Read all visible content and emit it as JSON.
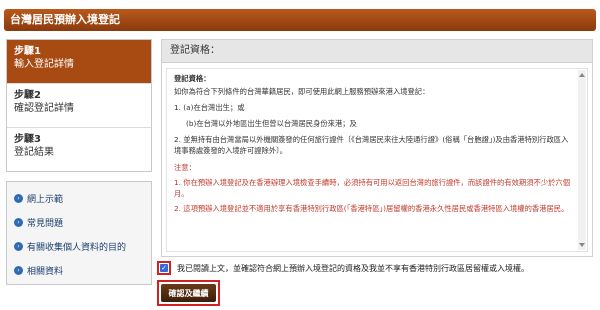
{
  "header": {
    "title": "台灣居民預辦入境登記"
  },
  "steps": [
    {
      "num": "步驟1",
      "label": "輸入登記詳情"
    },
    {
      "num": "步驟2",
      "label": "確認登記詳情"
    },
    {
      "num": "步驟3",
      "label": "登記結果"
    }
  ],
  "links": [
    {
      "icon": "arrow-circle-icon",
      "label": "網上示範"
    },
    {
      "icon": "arrow-circle-icon",
      "label": "常見問題"
    },
    {
      "icon": "arrow-circle-icon",
      "label": "有關收集個人資料的目的"
    },
    {
      "icon": "arrow-circle-icon",
      "label": "相關資料"
    }
  ],
  "panel": {
    "header": "登記資格：",
    "title": "登記資格：",
    "intro": "如你為符合下列條件的台灣華籍居民，即可使用此網上服務預辦來港入境登記：",
    "item1": "1. (a)在台灣出生；或",
    "item1b": "(b)在台灣以外地區出生但曾以台灣居民身份來港；及",
    "item2": "2. 並無持有由台灣當局以外機關簽發的任何旅行證件〔《台灣居民來往大陸通行證》(俗稱「台胞證」)及由香港特別行政區入境事務處簽發的入境許可證除外〕。",
    "note_label": "注意：",
    "note1": "1. 你在預辦入境登記及在香港辦理入境檢查手續時，必須持有可用以返回台灣的旅行證件，而該證件的有效期須不少於六個月。",
    "note2": "2. 這項預辦入境登記並不適用於享有香港特別行政區(「香港特區」)居留權的香港永久性居民或香港特區入境權的香港居民。"
  },
  "agree": {
    "checked": true,
    "text": "我已閱讀上文，並確認符合網上預辦入境登記的資格及我並不享有香港特別行政區居留權或入境權。"
  },
  "button": {
    "label": "確認及繼續"
  }
}
